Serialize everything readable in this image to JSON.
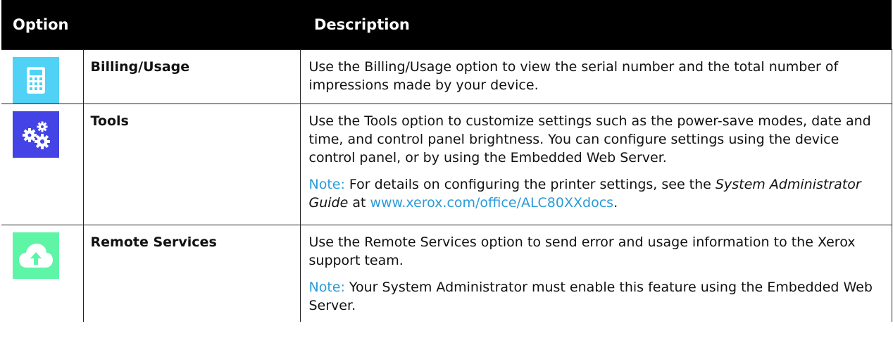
{
  "header": {
    "option": "Option",
    "description": "Description"
  },
  "rows": [
    {
      "icon": "calculator-icon",
      "icon_color": "#4fd2f5",
      "name": "Billing/Usage",
      "text": "Use the Billing/Usage option to view the serial number and the total number of impressions made by your device."
    },
    {
      "icon": "gears-icon",
      "icon_color": "#4343e6",
      "name": "Tools",
      "text": "Use the Tools option to customize settings such as the power-save modes, date and time, and control panel brightness. You can configure settings using the device control panel, or by using the Embedded Web Server.",
      "note_label": "Note:",
      "note_before": " For details on configuring the printer settings, see the ",
      "note_italic": "System Administrator Guide",
      "note_mid": " at ",
      "note_link": "www.xerox.com/office/ALC80XXdocs",
      "note_end": "."
    },
    {
      "icon": "cloud-upload-icon",
      "icon_color": "#5ef5a6",
      "name": "Remote Services",
      "text": "Use the Remote Services option to send error and usage information to the Xerox support team.",
      "note_label": "Note:",
      "note_text": " Your System Administrator must enable this feature using the Embedded Web Server."
    }
  ]
}
